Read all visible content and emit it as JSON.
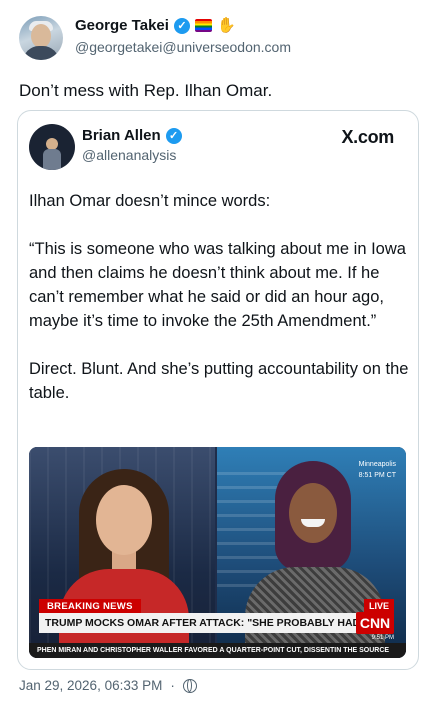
{
  "post": {
    "author_name": "George Takei",
    "author_handle": "@georgetakei@universeodon.com",
    "text": "Don’t mess with Rep. Ilhan Omar.",
    "timestamp": "Jan 29, 2026, 06:33 PM",
    "separator": "·",
    "flag_icon": "rainbow-flag-icon",
    "hand_icon": "raised-hand-icon",
    "visibility_icon": "globe-icon"
  },
  "quote": {
    "author_name": "Brian Allen",
    "author_handle": "@allenanalysis",
    "source_label": "X.com",
    "paragraphs": [
      "Ilhan Omar doesn’t mince words:",
      "“This is someone who was talking about me in Iowa and then claims he doesn’t think about me. If he can’t remember what he said or did an hour ago, maybe it’s time to invoke the 25th Amendment.”",
      "Direct. Blunt. And she’s putting accountability on the table."
    ]
  },
  "video": {
    "location": "Minneapolis",
    "location_time": "8:51 PM CT",
    "breaking_label": "BREAKING NEWS",
    "live_label": "LIVE",
    "headline": "TRUMP MOCKS OMAR AFTER ATTACK: \"SHE PROBABLY HAD HERSELF SPRAYED\"",
    "network_logo": "CNN",
    "small_time": "9:51 PM",
    "ticker": "PHEN MIRAN AND CHRISTOPHER WALLER FAVORED A QUARTER-POINT CUT, DISSENTIN THE SOURCE"
  },
  "colors": {
    "verified_blue": "#1d9bf0",
    "breaking_red": "#cc0000",
    "muted_text": "#536471"
  }
}
